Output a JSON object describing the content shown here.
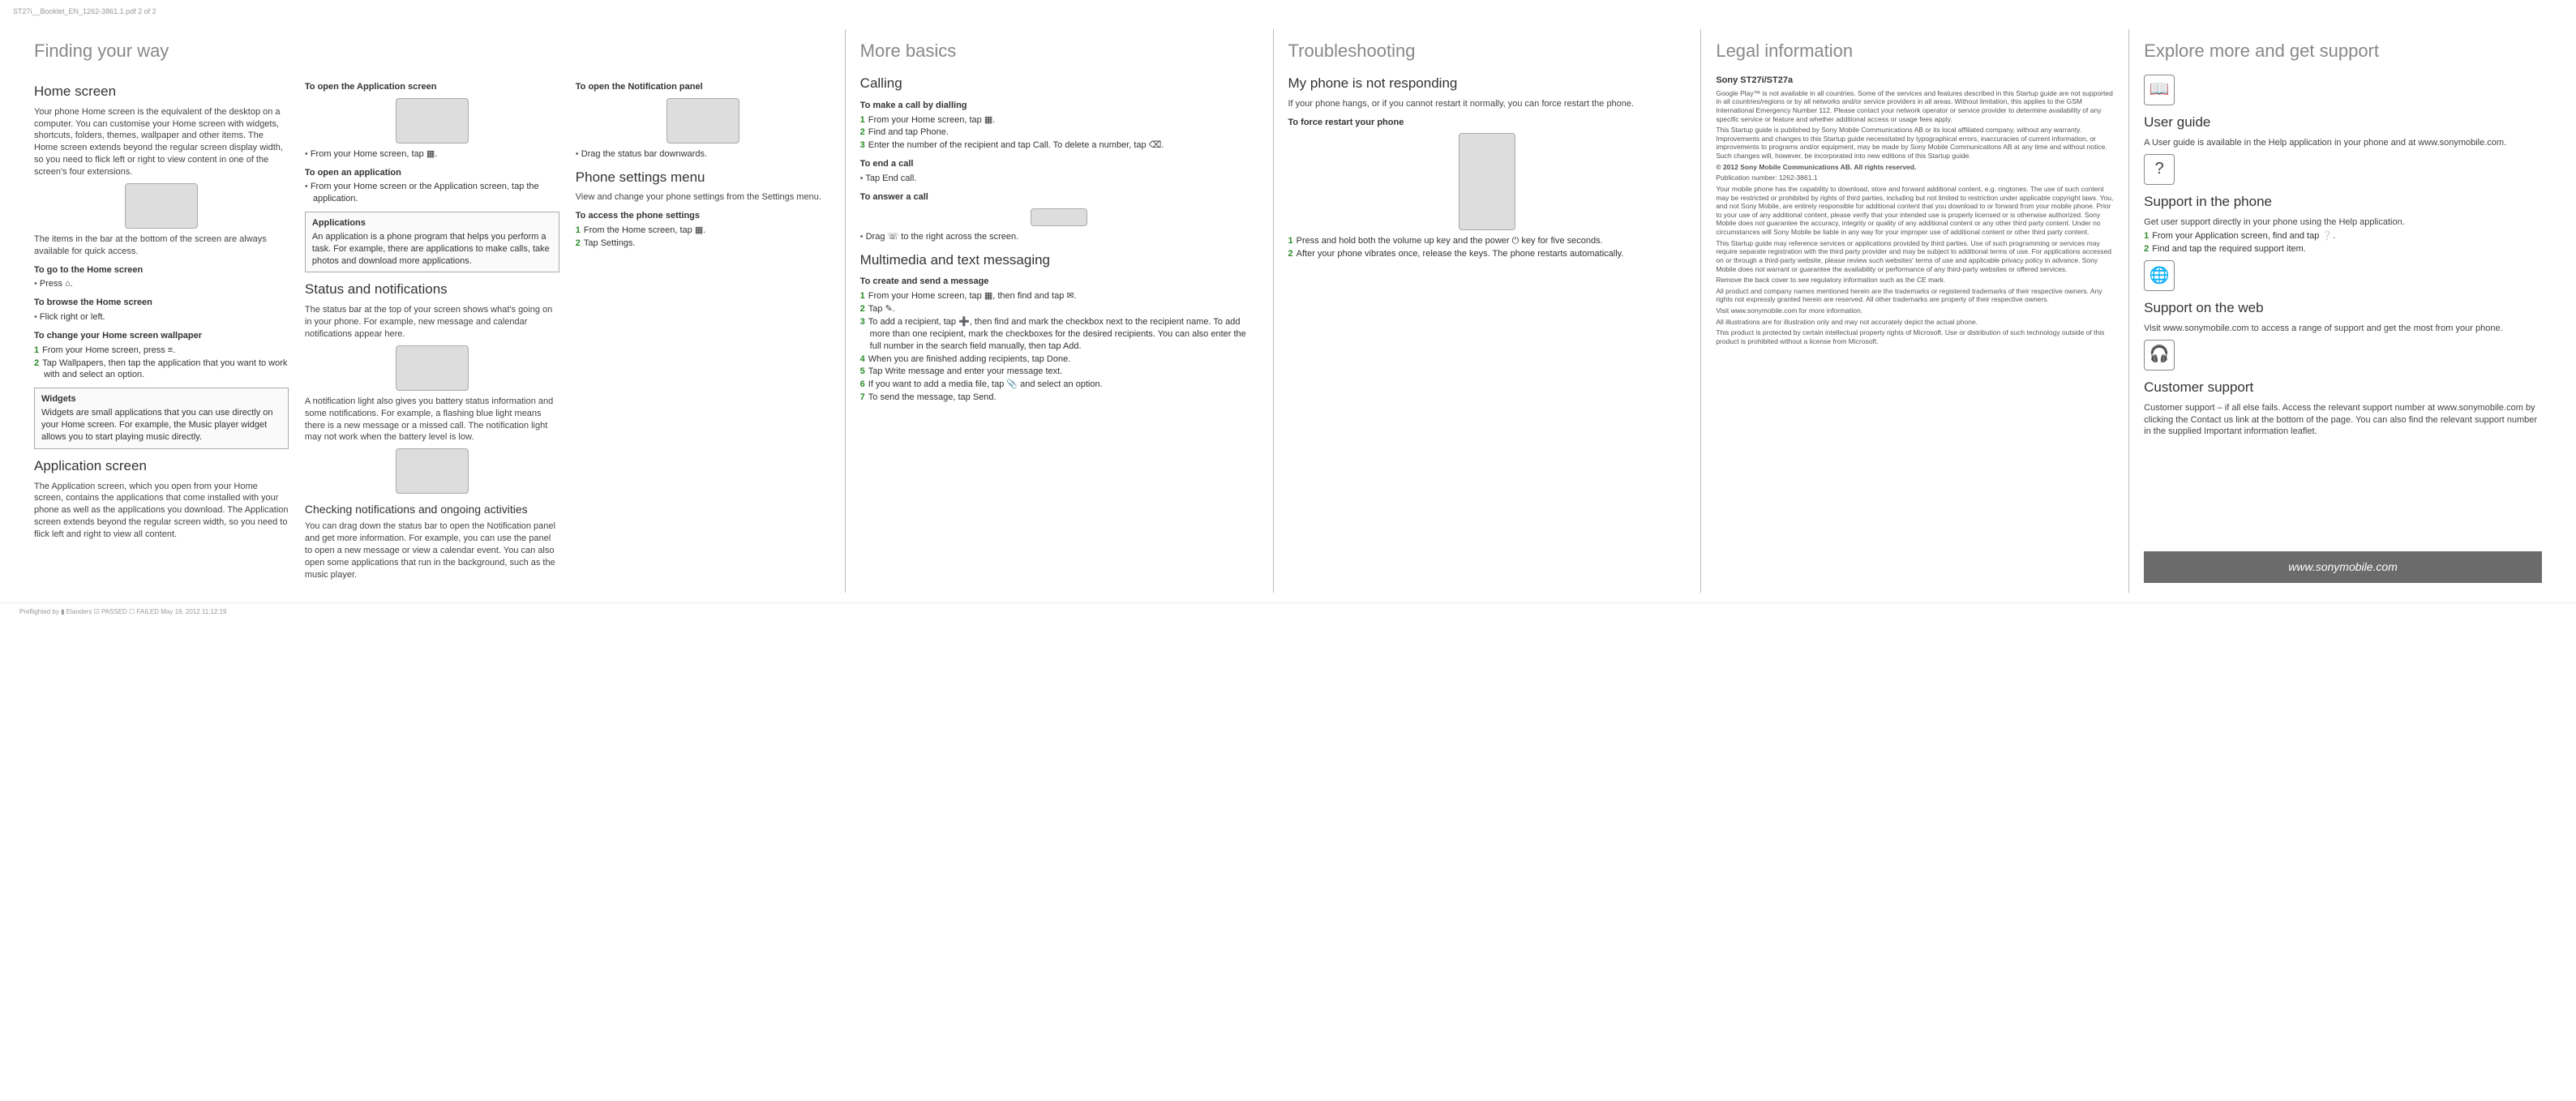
{
  "header": "ST27i__Booklet_EN_1262-3861.1.pdf  2  of   2",
  "footer": "Preflighted by  ▮ Elanders   ☑ PASSED  ☐ FAILED May 19, 2012  11:12:19",
  "url_bar": "www.sonymobile.com",
  "p1": {
    "title": "Finding your way",
    "col1": {
      "h_home": "Home screen",
      "home_para": "Your phone Home screen is the equivalent of the desktop on a computer. You can customise your Home screen with widgets, shortcuts, folders, themes, wallpaper and other items.\nThe Home screen extends beyond the regular screen display width, so you need to flick left or right to view content in one of the screen's four extensions.",
      "caption": "The items in the bar at the bottom of the screen are always available for quick access.",
      "h_go": "To go to the Home screen",
      "go_step": "Press ⌂.",
      "h_browse": "To browse the Home screen",
      "browse_step": "Flick right or left.",
      "h_wall": "To change your Home screen wallpaper",
      "wall_s1": "From your Home screen, press ≡.",
      "wall_s2": "Tap Wallpapers, then tap the application that you want to work with and select an option.",
      "box_widgets_t": "Widgets",
      "box_widgets_b": "Widgets are small applications that you can use directly on your Home screen. For example, the Music player widget allows you to start playing music directly.",
      "h_appscr": "Application screen",
      "appscr_para": "The Application screen, which you open from your Home screen, contains the applications that come installed with your phone as well as the applications you download.\nThe Application screen extends beyond the regular screen width, so you need to flick left and right to view all content."
    },
    "col2": {
      "h_openapp": "To open the Application screen",
      "openapp_step": "From your Home screen, tap ▦.",
      "h_openone": "To open an application",
      "openone_step": "From your Home screen or the Application screen, tap the application.",
      "box_apps_t": "Applications",
      "box_apps_b": "An application is a phone program that helps you perform a task. For example, there are applications to make calls, take photos and download more applications.",
      "h_status": "Status and notifications",
      "status_para": "The status bar at the top of your screen shows what's going on in your phone. For example, new message and calendar notifications appear here.",
      "notif_light": "A notification light also gives you battery status information and some notifications. For example, a flashing blue light means there is a new message or a missed call. The notification light may not work when the battery level is low.",
      "h_check": "Checking notifications and ongoing activities",
      "check_para": "You can drag down the status bar to open the Notification panel and get more information. For example, you can use the panel to open a new message or view a calendar event. You can also open some applications that run in the background, such as the music player."
    },
    "col3": {
      "h_opennotif": "To open the Notification panel",
      "opennotif_step": "Drag the status bar downwards.",
      "h_settings": "Phone settings menu",
      "settings_para": "View and change your phone settings from the Settings menu.",
      "h_access": "To access the phone settings",
      "acc_s1": "From the Home screen, tap ▦.",
      "acc_s2": "Tap Settings."
    }
  },
  "p2": {
    "title": "More basics",
    "h_call": "Calling",
    "h_dial": "To make a call by dialling",
    "dial_s1": "From your Home screen, tap ▦.",
    "dial_s2": "Find and tap Phone.",
    "dial_s3": "Enter the number of the recipient and tap Call. To delete a number, tap ⌫.",
    "h_end": "To end a call",
    "end_s": "Tap End call.",
    "h_ans": "To answer a call",
    "ans_s": "Drag ☏ to the right across the screen.",
    "h_mms": "Multimedia and text messaging",
    "h_send": "To create and send a message",
    "m_s1": "From your Home screen, tap ▦, then find and tap ✉.",
    "m_s2": "Tap ✎.",
    "m_s3": "To add a recipient, tap ➕, then find and mark the checkbox next to the recipient name. To add more than one recipient, mark the checkboxes for the desired recipients. You can also enter the full number in the search field manually, then tap Add.",
    "m_s4": "When you are finished adding recipients, tap Done.",
    "m_s5": "Tap Write message and enter your message text.",
    "m_s6": "If you want to add a media file, tap 📎 and select an option.",
    "m_s7": "To send the message, tap Send."
  },
  "p3": {
    "title": "Troubleshooting",
    "h_notres": "My phone is not responding",
    "notres_p": "If your phone hangs, or if you cannot restart it normally, you can force restart the phone.",
    "h_force": "To force restart your phone",
    "force_s1": "Press and hold both the volume up key and the power ⏻ key for five seconds.",
    "force_s2": "After your phone vibrates once, release the keys. The phone restarts automatically."
  },
  "p4": {
    "title": "Legal information",
    "h_model": "Sony ST27i/ST27a",
    "body1": "Google Play™ is not available in all countries. Some of the services and features described in this Startup guide are not supported in all countries/regions or by all networks and/or service providers in all areas. Without limitation, this applies to the GSM International Emergency Number 112. Please contact your network operator or service provider to determine availability of any specific service or feature and whether additional access or usage fees apply.",
    "body2": "This Startup guide is published by Sony Mobile Communications AB or its local affiliated company, without any warranty. Improvements and changes to this Startup guide necessitated by typographical errors, inaccuracies of current information, or improvements to programs and/or equipment, may be made by Sony Mobile Communications AB at any time and without notice. Such changes will, however, be incorporated into new editions of this Startup guide.",
    "copyright": "© 2012 Sony Mobile Communications AB. All rights reserved.",
    "pubnum": "Publication number: 1262-3861.1",
    "body3": "Your mobile phone has the capability to download, store and forward additional content, e.g. ringtones. The use of such content may be restricted or prohibited by rights of third parties, including but not limited to restriction under applicable copyright laws. You, and not Sony Mobile, are entirely responsible for additional content that you download to or forward from your mobile phone. Prior to your use of any additional content, please verify that your intended use is properly licensed or is otherwise authorized. Sony Mobile does not guarantee the accuracy, integrity or quality of any additional content or any other third party content. Under no circumstances will Sony Mobile be liable in any way for your improper use of additional content or other third party content.",
    "body4": "This Startup guide may reference services or applications provided by third parties. Use of such programming or services may require separate registration with the third party provider and may be subject to additional terms of use. For applications accessed on or through a third-party website, please review such websites' terms of use and applicable privacy policy in advance. Sony Mobile does not warrant or guarantee the availability or performance of any third-party websites or offered services.",
    "body5": "Remove the back cover to see regulatory information such as the CE mark.",
    "body6": "All product and company names mentioned herein are the trademarks or registered trademarks of their respective owners. Any rights not expressly granted herein are reserved. All other trademarks are property of their respective owners.",
    "body7": "Visit www.sonymobile.com for more information.",
    "body8": "All illustrations are for illustration only and may not accurately depict the actual phone.",
    "body9": "This product is protected by certain intellectual property rights of Microsoft. Use or distribution of such technology outside of this product is prohibited without a license from Microsoft."
  },
  "p5": {
    "title": "Explore more and get support",
    "h_guide": "User guide",
    "guide_p": "A User guide is available in the Help application in your phone and at www.sonymobile.com.",
    "h_phone": "Support in the phone",
    "phone_p": "Get user support directly in your phone using the Help application.",
    "phone_s1": "From your Application screen, find and tap ❔.",
    "phone_s2": "Find and tap the required support item.",
    "h_web": "Support on the web",
    "web_p": "Visit www.sonymobile.com to access a range of support and get the most from your phone.",
    "h_cust": "Customer support",
    "cust_p": "Customer support – if all else fails. Access the relevant support number at www.sonymobile.com by clicking the Contact us link at the bottom of the page. You can also find the relevant support number in the supplied Important information leaflet."
  }
}
